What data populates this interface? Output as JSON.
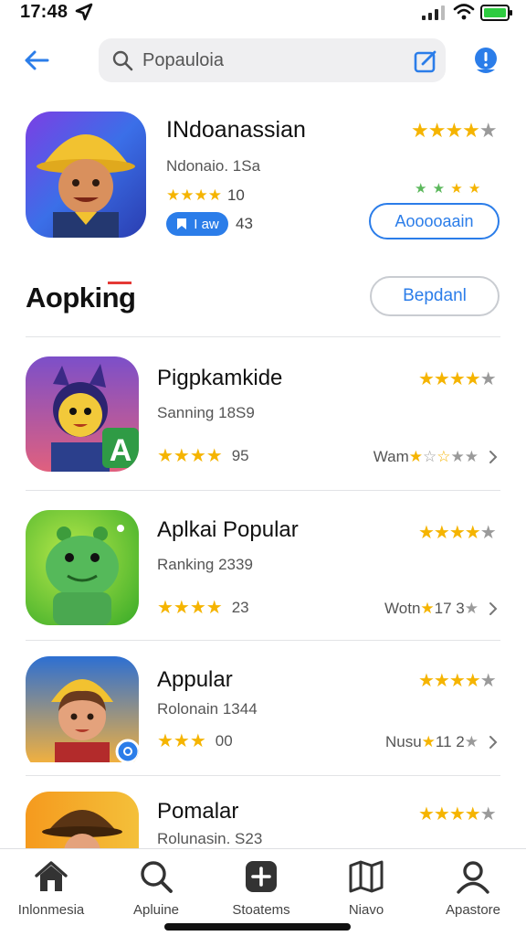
{
  "status_bar": {
    "time": "17:48"
  },
  "search": {
    "query": "Popauloia"
  },
  "featured": {
    "title": "INdoanassian",
    "subtitle": "Ndonaio. 1Sa",
    "rating_count": "10",
    "badge_label": "I aw",
    "badge_count": "43",
    "button_label": "Aooooaain"
  },
  "section": {
    "title": "Aopking",
    "button_label": "Bepdanl"
  },
  "apps": [
    {
      "name": "Pigpkamkide",
      "subtitle": "Sanning 18S9",
      "stars_value": "95",
      "meta_prefix": "Wam",
      "meta_value": ""
    },
    {
      "name": "Aplkai Popular",
      "subtitle": "Ranking 2339",
      "stars_value": "23",
      "meta_prefix": "Wotn",
      "meta_value": "17 3"
    },
    {
      "name": "Appular",
      "subtitle": "Rolonain 1344",
      "stars_value": "00",
      "meta_prefix": "Nusu",
      "meta_value": "11 2"
    },
    {
      "name": "Pomalar",
      "subtitle": "Rolunasin. S23"
    }
  ],
  "tabs": [
    {
      "label": "Inlonmesia",
      "icon": "home-icon"
    },
    {
      "label": "Apluine",
      "icon": "search-icon"
    },
    {
      "label": "Stoatems",
      "icon": "plus-square-icon"
    },
    {
      "label": "Niavo",
      "icon": "map-icon"
    },
    {
      "label": "Apastore",
      "icon": "person-icon"
    }
  ],
  "colors": {
    "accent": "#2b7de9",
    "star": "#f5b400",
    "star_off": "#9a9a9a"
  }
}
